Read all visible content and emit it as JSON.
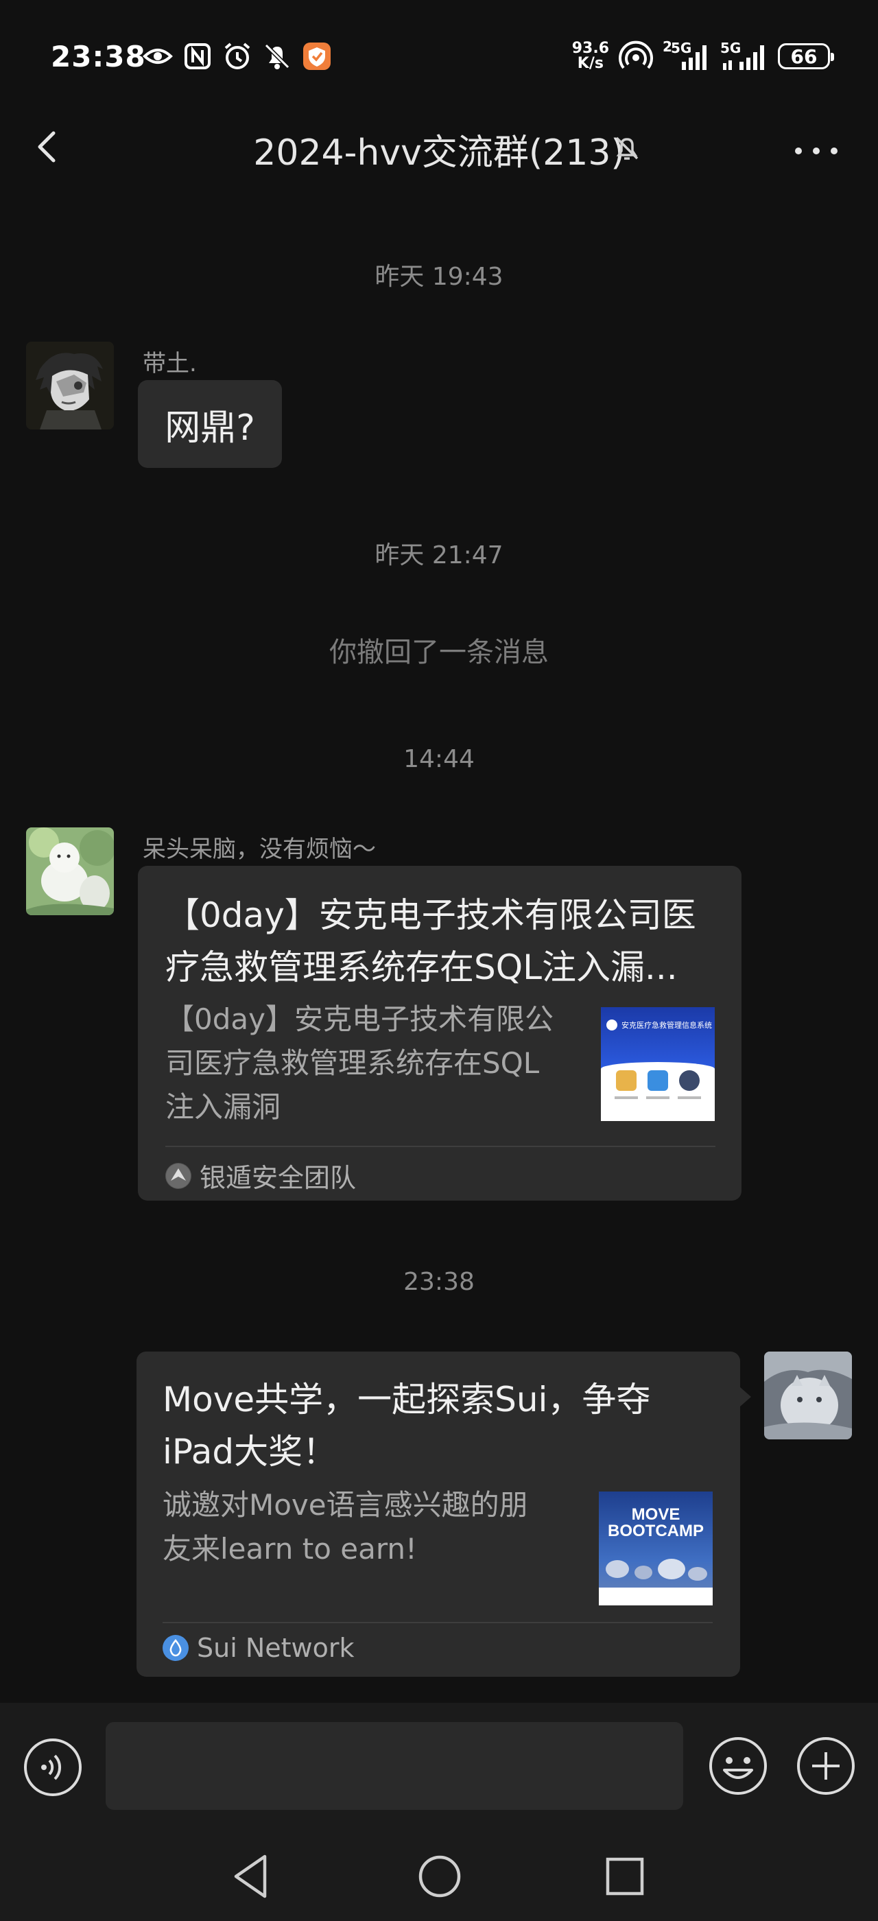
{
  "status_bar": {
    "time": "23:38",
    "net_speed_value": "93.6",
    "net_speed_unit": "K/s",
    "signal1_label": "2",
    "signal1_tech": "5G",
    "signal2_tech": "5G",
    "battery": "66",
    "icons": [
      "eye-icon",
      "nfc-icon",
      "alarm-icon",
      "bell-off-icon",
      "app-shield-icon",
      "hotspot-icon",
      "signal-icon",
      "signal-icon"
    ]
  },
  "header": {
    "title": "2024-hvv交流群(213)",
    "icons": [
      "back-arrow-icon",
      "mute-bell-icon",
      "more-dots-icon"
    ]
  },
  "chat": {
    "time_1": "昨天 19:43",
    "msg_1": {
      "sender": "带土.",
      "text": "网鼎?"
    },
    "time_2": "昨天 21:47",
    "recall_notice": "你撤回了一条消息",
    "time_3": "14:44",
    "msg_2": {
      "sender": "呆头呆脑，没有烦恼～",
      "card_title_1": "【0day】安克电子技术有限公司医",
      "card_title_2": "疗急救管理系统存在SQL注入漏...",
      "card_desc_1": "【0day】安克电子技术有限公",
      "card_desc_2": "司医疗急救管理系统存在SQL",
      "card_desc_3": "注入漏洞",
      "thumb_title": "安克医疗急救管理信息系统",
      "source": "银遁安全团队"
    },
    "time_4": "23:38",
    "msg_3": {
      "card_title_1": "Move共学，一起探索Sui，争夺",
      "card_title_2": "iPad大奖！",
      "card_desc_1": "诚邀对Move语言感兴趣的朋",
      "card_desc_2": "友来learn to earn!",
      "thumb_line_1": "MOVE",
      "thumb_line_2": "BOOTCAMP",
      "source": "Sui Network"
    }
  },
  "input_bar": {
    "icons": [
      "voice-icon",
      "emoji-icon",
      "plus-icon"
    ]
  },
  "nav_bar": {
    "icons": [
      "nav-back-icon",
      "nav-home-icon",
      "nav-recent-icon"
    ]
  },
  "colors": {
    "background": "#111111",
    "bubble": "#2c2c2c",
    "input_bar": "#1b1b1b",
    "muted_text": "#8c8c8c"
  }
}
